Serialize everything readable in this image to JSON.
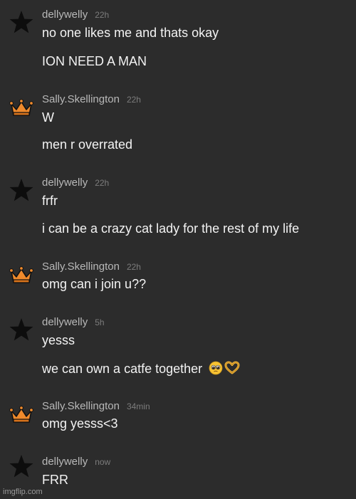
{
  "messages": [
    {
      "user": "dellywelly",
      "avatar": "star-icon",
      "time": "22h",
      "lines": [
        "no one likes me and thats okay",
        "ION NEED A MAN"
      ]
    },
    {
      "user": "Sally.Skellington",
      "avatar": "crown-icon",
      "time": "22h",
      "lines": [
        "W",
        "men r overrated"
      ]
    },
    {
      "user": "dellywelly",
      "avatar": "star-icon",
      "time": "22h",
      "lines": [
        "frfr",
        "i can be a crazy cat lady for the rest of my life"
      ]
    },
    {
      "user": "Sally.Skellington",
      "avatar": "crown-icon",
      "time": "22h",
      "lines": [
        "omg can i join u??"
      ]
    },
    {
      "user": "dellywelly",
      "avatar": "star-icon",
      "time": "5h",
      "lines": [
        "yesss",
        "we can own a catfe together"
      ],
      "emojis": [
        "pleading-face-icon",
        "heart-hands-icon"
      ]
    },
    {
      "user": "Sally.Skellington",
      "avatar": "crown-icon",
      "time": "34min",
      "lines": [
        "omg yesss<3"
      ]
    },
    {
      "user": "dellywelly",
      "avatar": "star-icon",
      "time": "now",
      "lines": [
        "FRR"
      ]
    }
  ],
  "watermark": "imgflip.com",
  "colors": {
    "background": "#2c2c2c",
    "crown": "#ef8a2c",
    "star": "#0d0d0d",
    "username": "#b8b8b8",
    "timestamp": "#7c7c7c"
  }
}
